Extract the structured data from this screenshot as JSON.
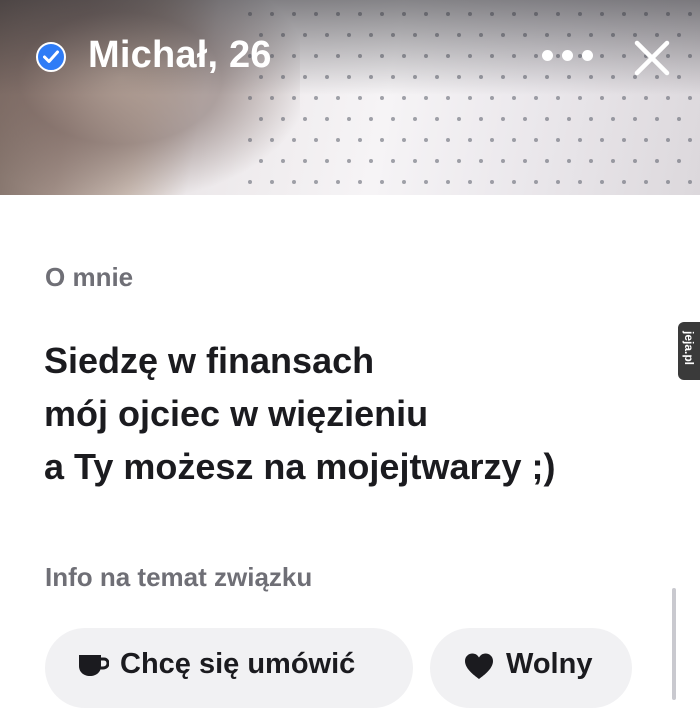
{
  "profile": {
    "name_age": "Michał, 26"
  },
  "header": {
    "verified_icon": "verified-check-icon",
    "more_icon": "more-dots-icon",
    "close_icon": "close-icon"
  },
  "about": {
    "title": "O mnie",
    "lines": [
      "Siedzę w finansach",
      "mój ojciec w więzieniu",
      "a Ty możesz na mojejtwarzy ;)"
    ]
  },
  "relationship": {
    "title": "Info na temat związku",
    "chips": [
      {
        "icon": "coffee-cup-icon",
        "label": "Chcę się umówić"
      },
      {
        "icon": "heart-icon",
        "label": "Wolny"
      }
    ]
  },
  "watermark": "jeja.pl",
  "colors": {
    "verified": "#2f7cf6",
    "text": "#1b1b1f",
    "muted": "#6f6f76",
    "chip_bg": "#f1f1f3"
  }
}
